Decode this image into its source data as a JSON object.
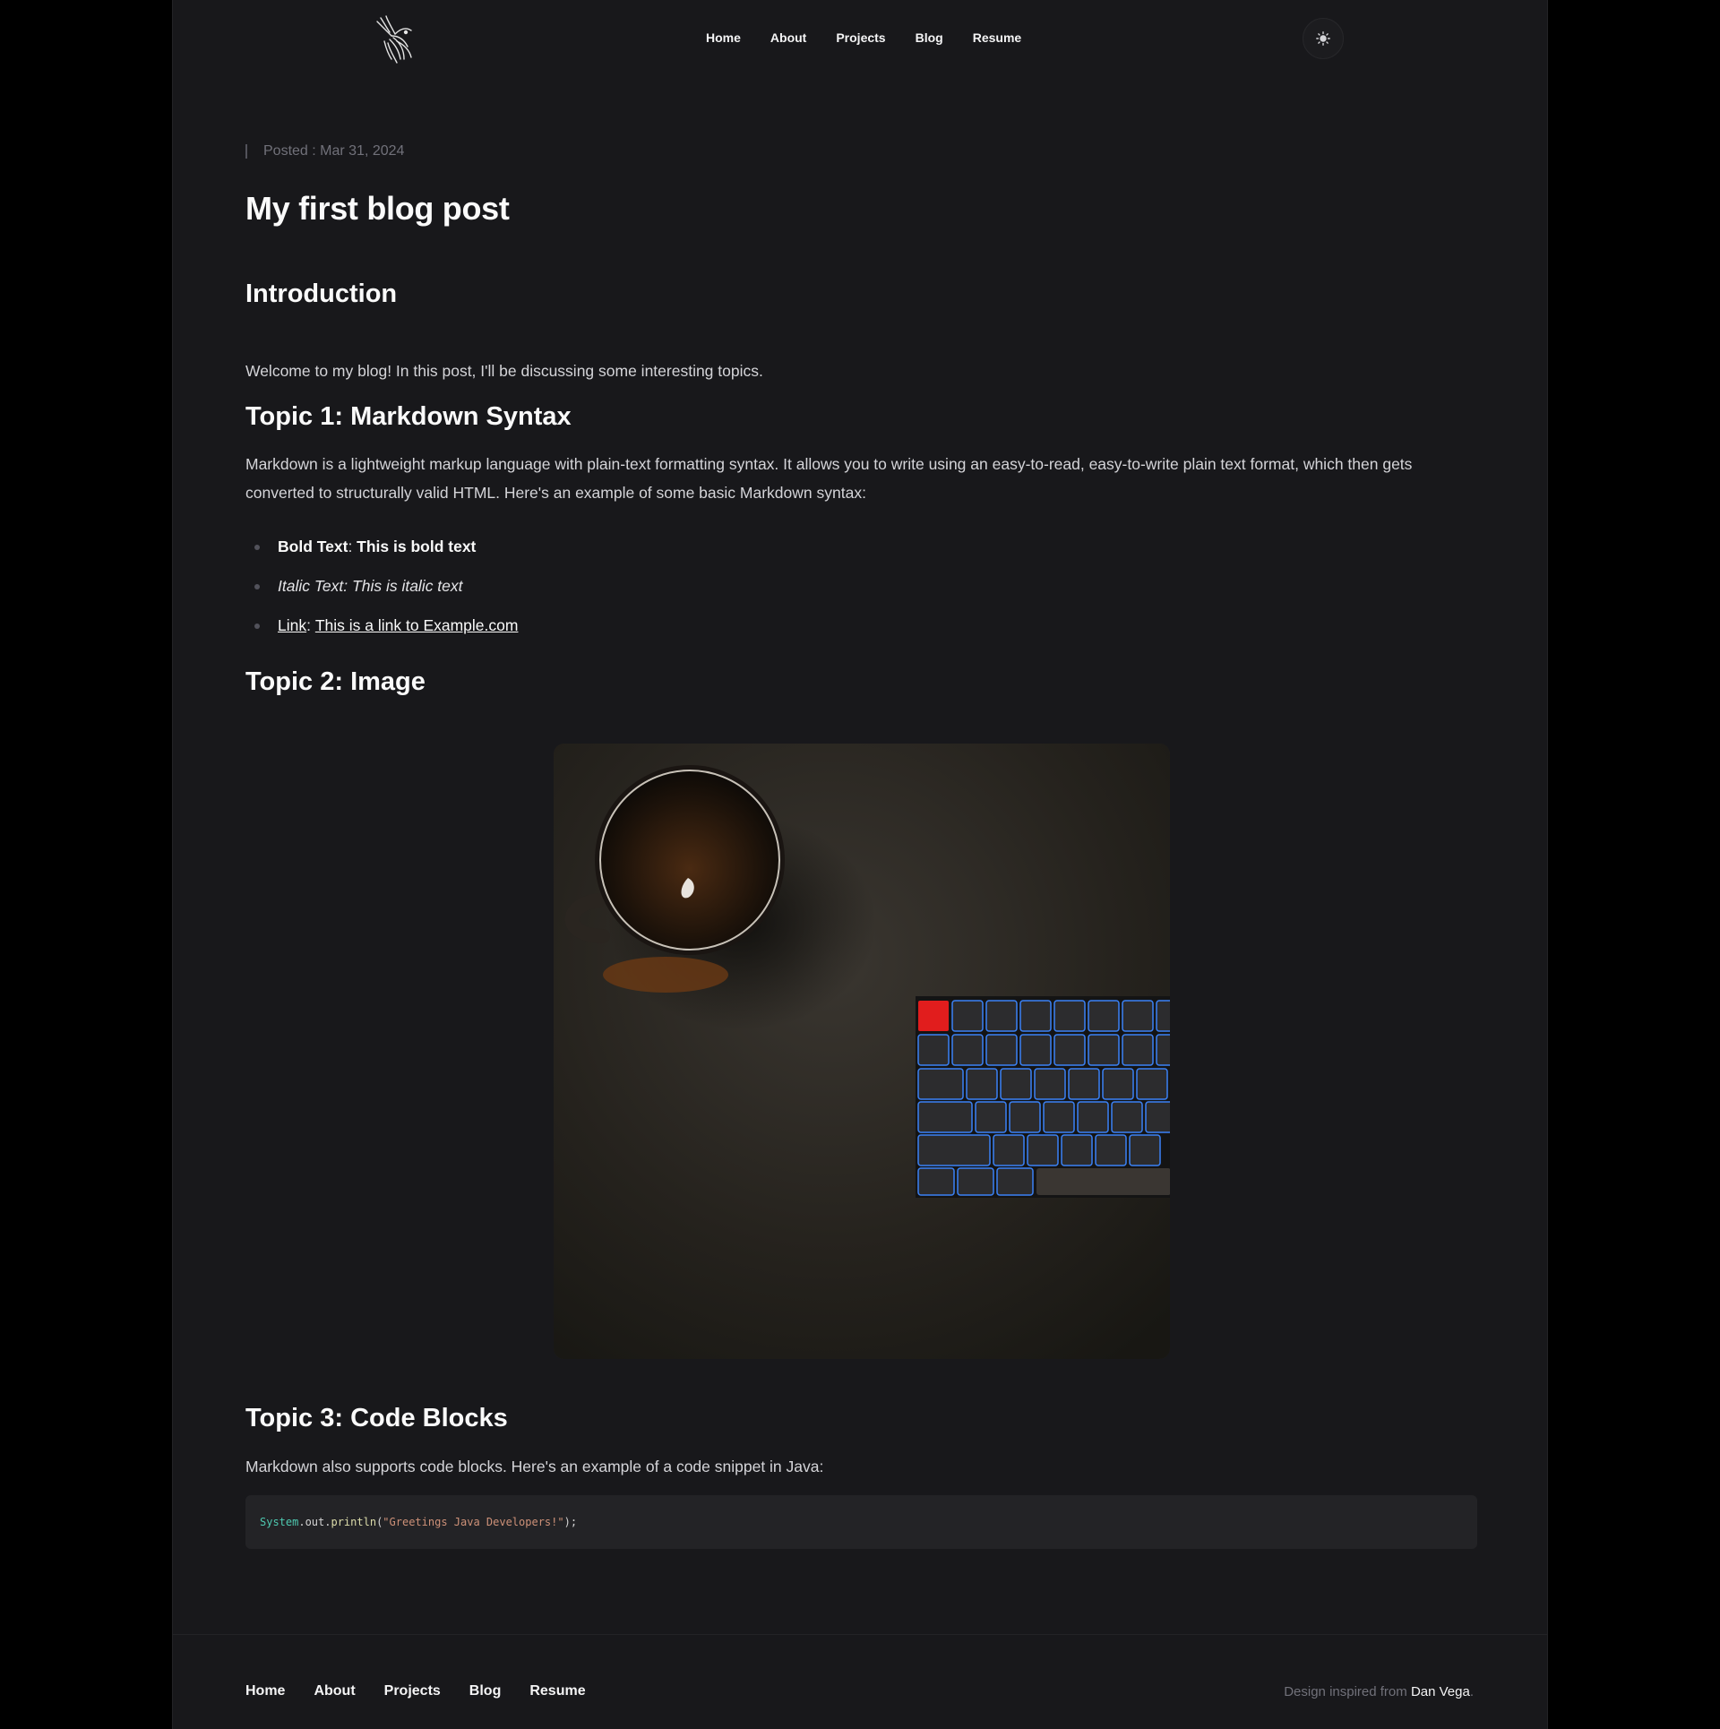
{
  "nav": {
    "items": [
      "Home",
      "About",
      "Projects",
      "Blog",
      "Resume"
    ]
  },
  "theme_toggle": {
    "icon": "sun-icon"
  },
  "post": {
    "posted": "Posted : Mar 31, 2024",
    "title": "My first blog post",
    "intro_heading": "Introduction",
    "intro_text": "Welcome to my blog! In this post, I'll be discussing some interesting topics.",
    "topic1_heading": "Topic 1: Markdown Syntax",
    "topic1_text": "Markdown is a lightweight markup language with plain-text formatting syntax. It allows you to write using an easy-to-read, easy-to-write plain text format, which then gets converted to structurally valid HTML. Here's an example of some basic Markdown syntax:",
    "list": {
      "bold_label": "Bold Text",
      "bold_value": "This is bold text",
      "italic_label": "Italic Text",
      "italic_value": "This is italic text",
      "link_label": "Link",
      "link_value": "This is a link to Example.com",
      "separator": ": "
    },
    "topic2_heading": "Topic 2: Image",
    "topic3_heading": "Topic 3: Code Blocks",
    "topic3_text": "Markdown also supports code blocks. Here's an example of a code snippet in Java:",
    "code": {
      "class": "System",
      "member": ".out.",
      "method": "println",
      "open": "(",
      "string": "\"Greetings Java Developers!\"",
      "close": ");"
    }
  },
  "footer": {
    "items": [
      "Home",
      "About",
      "Projects",
      "Blog",
      "Resume"
    ],
    "credit_prefix": "Design inspired from ",
    "credit_author": "Dan Vega",
    "credit_suffix": "."
  },
  "colors": {
    "page_bg": "#18181b",
    "outer_bg": "#000000",
    "code_bg": "#232326",
    "accent_red_key": "#e11d1d",
    "keyboard_glow": "#3b82f6"
  }
}
